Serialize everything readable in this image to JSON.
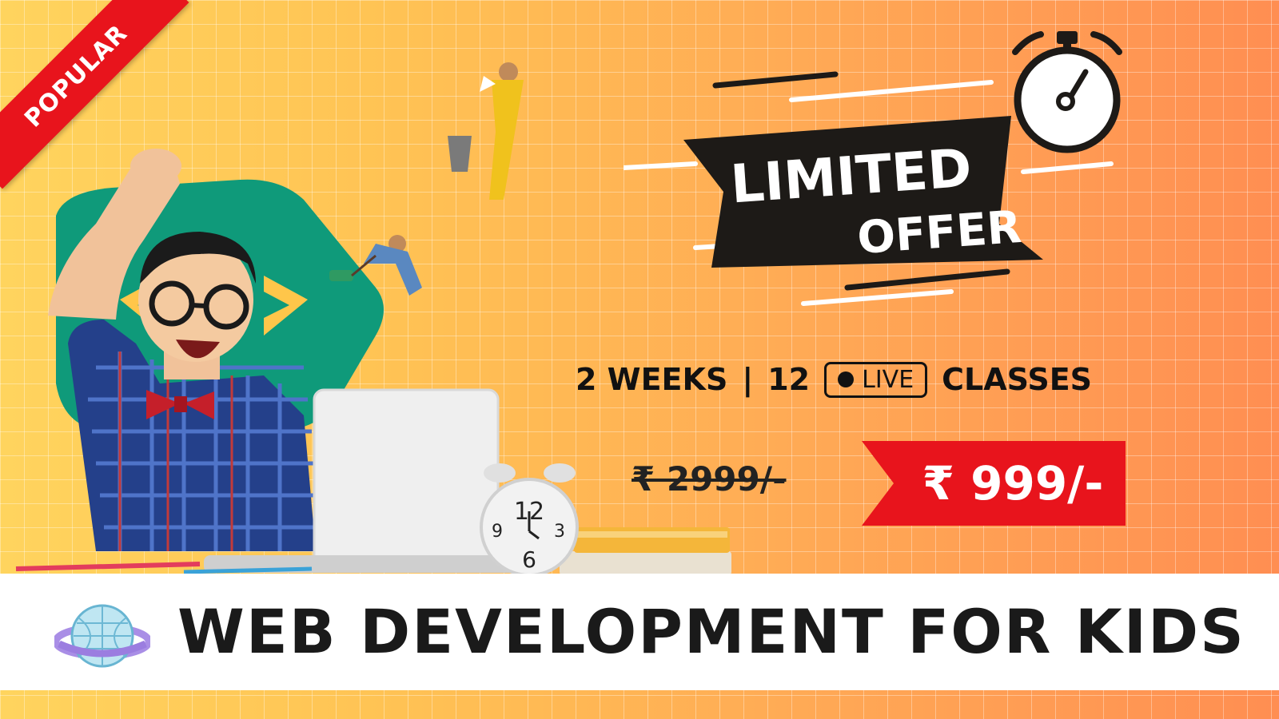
{
  "badge": {
    "label": "POPULAR",
    "color": "#e8141c"
  },
  "offer": {
    "line1": "LIMITED",
    "line2": "OFFER",
    "icon": "stopwatch-icon"
  },
  "details": {
    "weeks": "2 WEEKS",
    "separator": "|",
    "count": "12",
    "live_label": "LIVE",
    "classes": "CLASSES"
  },
  "price": {
    "old": "₹ 2999/-",
    "new": "₹ 999/-",
    "tag_color": "#e8141c"
  },
  "title": {
    "text": "WEB DEVELOPMENT FOR KIDS",
    "icon": "globe-icon"
  },
  "clock": {
    "twelve": "12",
    "nine": "9",
    "three": "3",
    "six": "6"
  },
  "colors": {
    "background_start": "#ffd45e",
    "background_end": "#ff8e52",
    "accent_green": "#0f9a7a",
    "label_dark": "#1d1a17"
  }
}
